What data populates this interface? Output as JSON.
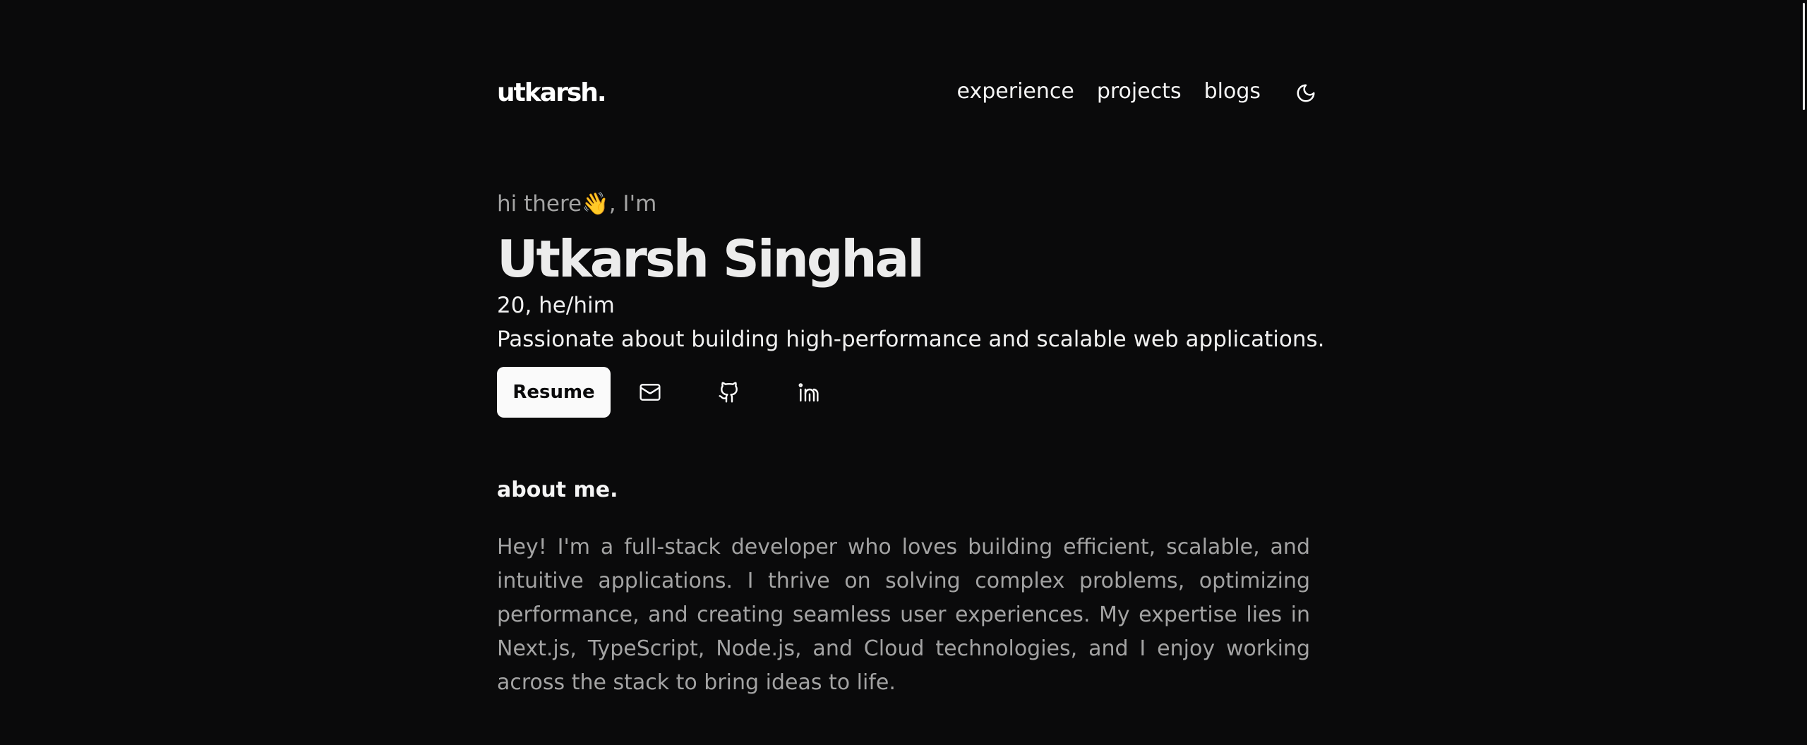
{
  "header": {
    "logo": "utkarsh.",
    "nav": [
      {
        "label": "experience"
      },
      {
        "label": "projects"
      },
      {
        "label": "blogs"
      }
    ],
    "theme_icon": "moon-icon"
  },
  "hero": {
    "greeting": "hi there👋, I'm",
    "name": "Utkarsh Singhal",
    "age_pronouns": "20, he/him",
    "tagline": "Passionate about building high-performance and scalable web applications.",
    "resume_label": "Resume",
    "social_icons": [
      "mail-icon",
      "github-icon",
      "linkedin-icon"
    ]
  },
  "about": {
    "heading": "about me.",
    "text": "Hey! I'm a full-stack developer who loves building efficient, scalable, and intuitive applications. I thrive on solving complex problems, optimizing performance, and creating seamless user experiences. My expertise lies in Next.js, TypeScript, Node.js, and Cloud technologies, and I enjoy working across the stack to bring ideas to life."
  },
  "colors": {
    "background": "#0a0a0b",
    "text_primary": "#f5f5f5",
    "text_muted": "#a3a3a3",
    "button_bg": "#fafafa"
  }
}
